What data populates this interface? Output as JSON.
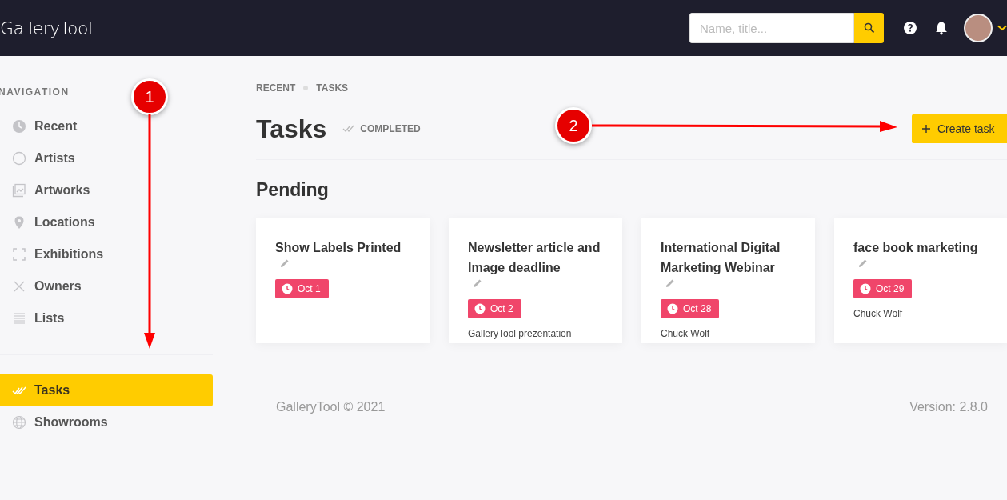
{
  "header": {
    "logo": "GalleryTool",
    "search": {
      "placeholder": "Name, title..."
    }
  },
  "sidebar": {
    "heading": "NAVIGATION",
    "items": [
      {
        "label": "Recent",
        "kind": "clock",
        "selected": false
      },
      {
        "label": "Artists",
        "kind": "circle",
        "selected": false
      },
      {
        "label": "Artworks",
        "kind": "images",
        "selected": false
      },
      {
        "label": "Locations",
        "kind": "pin",
        "selected": false
      },
      {
        "label": "Exhibitions",
        "kind": "frame",
        "selected": false
      },
      {
        "label": "Owners",
        "kind": "cross",
        "selected": false
      },
      {
        "label": "Lists",
        "kind": "lines",
        "selected": false
      }
    ],
    "bottom_items": [
      {
        "label": "Tasks",
        "kind": "check",
        "selected": true
      },
      {
        "label": "Showrooms",
        "kind": "globe",
        "selected": false
      }
    ]
  },
  "breadcrumb": [
    "RECENT",
    "TASKS"
  ],
  "page": {
    "title": "Tasks",
    "completed_link": "COMPLETED",
    "create_button": "Create task"
  },
  "section_title": "Pending",
  "tasks": [
    {
      "title": "Show Labels Printed",
      "due": "Oct 1"
    },
    {
      "title": "Newsletter article and Image deadline",
      "due": "Oct 2",
      "assignee": "GalleryTool prezentation"
    },
    {
      "title": "International Digital Marketing Webinar",
      "due": "Oct 28",
      "assignee": "Chuck Wolf"
    },
    {
      "title": "face book marketing",
      "due": "Oct 29",
      "assignee": "Chuck Wolf"
    }
  ],
  "footer": {
    "copyright": "GalleryTool © 2021",
    "version": "Version: 2.8.0"
  },
  "annotations": [
    {
      "number": "1",
      "kind": "down"
    },
    {
      "number": "2",
      "kind": "right"
    }
  ]
}
